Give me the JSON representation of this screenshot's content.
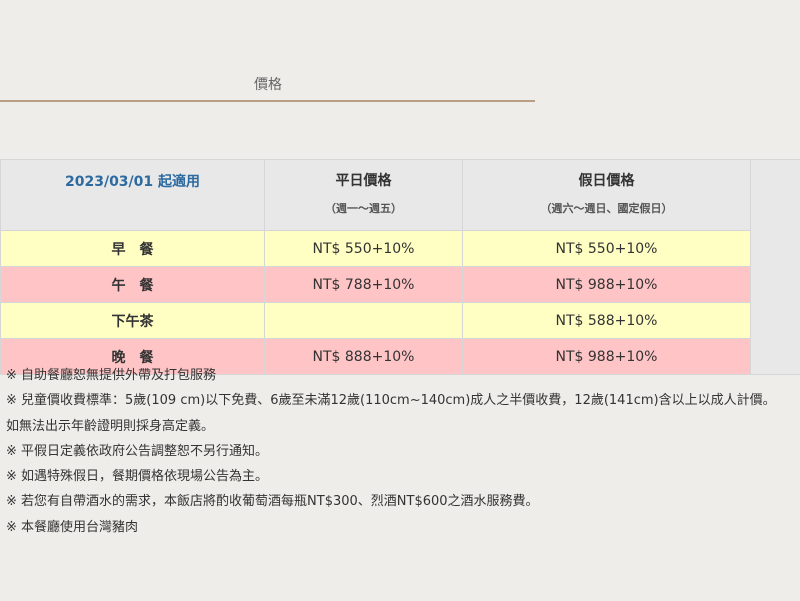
{
  "tab": {
    "label": "價格"
  },
  "table": {
    "header": {
      "date_label": "2023/03/01 起適用",
      "weekday_title": "平日價格",
      "weekday_sub": "（週一～週五）",
      "holiday_title": "假日價格",
      "holiday_sub": "（週六～週日、國定假日）"
    },
    "rows": [
      {
        "meal": "早　餐",
        "weekday": "NT$ 550+10%",
        "holiday": "NT$ 550+10%",
        "color": "#ffffc4"
      },
      {
        "meal": "午　餐",
        "weekday": "NT$ 788+10%",
        "holiday": "NT$ 988+10%",
        "color": "#ffc4c6"
      },
      {
        "meal": "下午茶",
        "weekday": "",
        "holiday": "NT$ 588+10%",
        "color": "#ffffc4"
      },
      {
        "meal": "晚　餐",
        "weekday": "NT$ 888+10%",
        "holiday": "NT$ 988+10%",
        "color": "#ffc4c6"
      }
    ]
  },
  "notes": [
    "※ 自助餐廳恕無提供外帶及打包服務",
    "※ 兒童價收費標準：5歲(109 cm)以下免費、6歲至未滿12歲(110cm~140cm)成人之半價收費，12歲(141cm)含以上以成人計價。",
    "如無法出示年齡證明則採身高定義。",
    "※ 平假日定義依政府公告調整恕不另行通知。",
    "※ 如遇特殊假日，餐期價格依現場公告為主。",
    "※ 若您有自帶酒水的需求，本飯店將酌收葡萄酒每瓶NT$300、烈酒NT$600之酒水服務費。",
    "※ 本餐廳使用台灣豬肉"
  ],
  "colors": {
    "header_blue": "#2c6aa0",
    "tab_underline": "#b89f84",
    "row_yellow": "#ffffc4",
    "row_pink": "#ffc4c6"
  }
}
